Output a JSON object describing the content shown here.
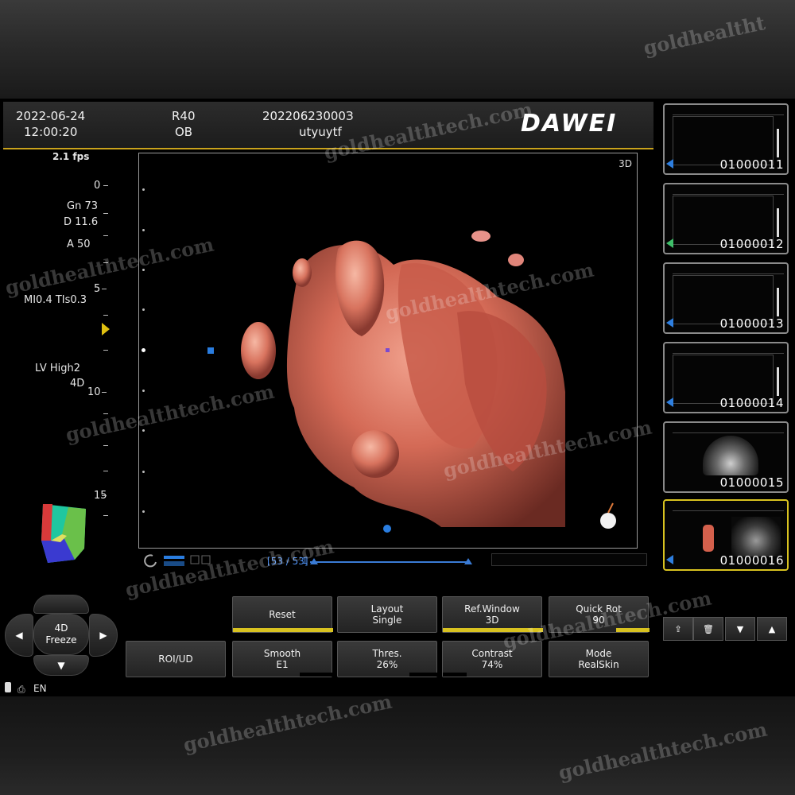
{
  "header": {
    "brand": "DAWEI",
    "patient_id": "20220623000З",
    "patient_name": "utyuytf",
    "probe": "R40",
    "exam": "OB",
    "date": "2022-06-24",
    "time": "12:00:20"
  },
  "readouts": {
    "fps": "2.1 fps",
    "gn": "Gn 73",
    "depth": "D 11.6",
    "a": "A 50",
    "mi_tis": "MI0.4 TIs0.3",
    "lv": "LV High2",
    "mode": "4D",
    "scale_0": "0",
    "scale_5": "5",
    "scale_10": "10",
    "scale_15": "15"
  },
  "viewport": {
    "mode": "3D"
  },
  "cine": {
    "frame_label": "[53 / 53]",
    "marker": "1"
  },
  "softkeys": {
    "reset": "Reset",
    "layout_l1": "Layout",
    "layout_l2": "Single",
    "refwin_l1": "Ref.Window",
    "refwin_l2": "3D",
    "quickrot_l1": "Quick Rot",
    "quickrot_l2": "90",
    "roi": "ROI/UD",
    "smooth_l1": "Smooth",
    "smooth_l2": "E1",
    "thres_l1": "Thres.",
    "thres_l2": "26%",
    "contrast_l1": "Contrast",
    "contrast_l2": "74%",
    "mode_l1": "Mode",
    "mode_l2": "RealSkin"
  },
  "nav": {
    "center_l1": "4D",
    "center_l2": "Freeze"
  },
  "status": {
    "lang": "EN"
  },
  "thumbnails": [
    {
      "label": "01000011"
    },
    {
      "label": "01000012"
    },
    {
      "label": "01000013"
    },
    {
      "label": "01000014"
    },
    {
      "label": "01000015"
    },
    {
      "label": "01000016"
    }
  ],
  "watermark": "goldhealthtech.com",
  "watermark_short": "goldhealtht",
  "colors": {
    "accent": "#d8c220",
    "header_rule": "#c9a21c",
    "cine_blue": "#3a7bd5",
    "render_tissue": "#e07a68"
  }
}
